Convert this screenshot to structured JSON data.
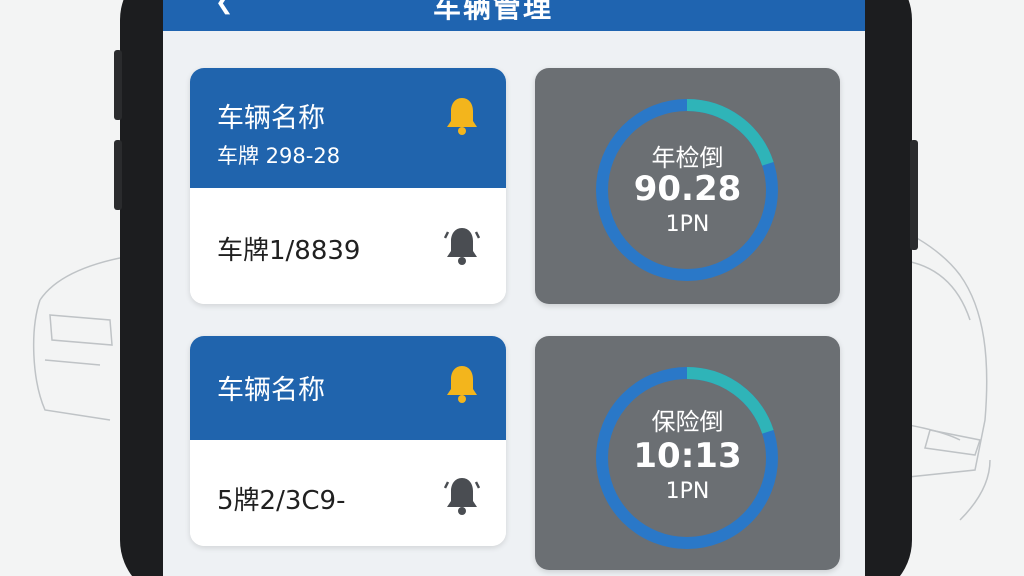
{
  "header": {
    "title": "车辆管理"
  },
  "cards": [
    {
      "name": "车辆名称",
      "plate": "车牌 298-28",
      "bottom": "车牌1/8839"
    },
    {
      "name": "车辆名称",
      "plate": "",
      "bottom": "5牌2/3C9-"
    }
  ],
  "gauges": [
    {
      "title": "年检倒",
      "value": "90.28",
      "unit": "1PN",
      "progress": 0.2
    },
    {
      "title": "保险倒",
      "value": "10:13",
      "unit": "1PN",
      "progress": 0.2
    }
  ],
  "icons": {
    "back": "back-arrow-icon",
    "bell_active": "bell-icon",
    "bell_muted": "bell-icon"
  },
  "colors": {
    "primary": "#2064ad",
    "bell_active": "#f3b51c",
    "bell_muted": "#4a4d52",
    "gauge_bg": "#6b6f73",
    "gauge_ring": "#2a78c8",
    "gauge_progress": "#2fb4b8"
  }
}
